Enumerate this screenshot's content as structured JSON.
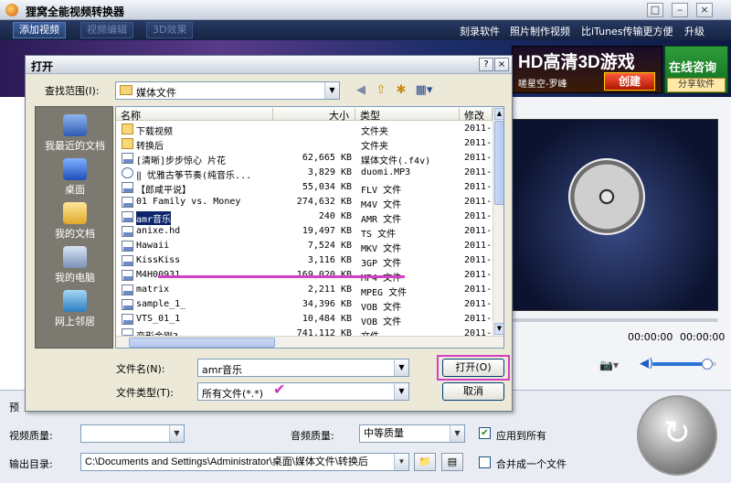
{
  "app": {
    "title": "狸窝全能视频转换器",
    "window_buttons": [
      "□",
      "–",
      "×"
    ],
    "toolbar": {
      "add_video": "添加视频",
      "video_edit": "视频编辑",
      "effect_3d": "3D效果"
    },
    "links": [
      "刻录软件",
      "照片制作视频",
      "比iTunes传输更方便",
      "升级"
    ],
    "banner": {
      "ad_title": "HD高清3D游戏",
      "ad_sub": "嗟星空-罗峰",
      "ad_button": "创建",
      "online_title": "在线咨询",
      "share": "分享软件"
    },
    "player": {
      "time_current": "00:00:00",
      "time_total": "00:00:00",
      "volume": 0.85
    },
    "settings": {
      "preset_label": "预",
      "video_quality_label": "视频质量:",
      "video_quality_value": "",
      "audio_quality_label": "音频质量:",
      "audio_quality_value": "中等质量",
      "apply_all_label": "应用到所有",
      "apply_all_checked": true,
      "output_label": "输出目录:",
      "output_path": "C:\\Documents and Settings\\Administrator\\桌面\\媒体文件\\转换后",
      "merge_label": "合并成一个文件",
      "merge_checked": false
    }
  },
  "dialog": {
    "title": "打开",
    "help": "?",
    "close": "×",
    "look_in_label": "查找范围(I):",
    "look_in_value": "媒体文件",
    "places": [
      {
        "label": "我最近的文档",
        "icon": "recent-documents-icon"
      },
      {
        "label": "桌面",
        "icon": "desktop-icon"
      },
      {
        "label": "我的文档",
        "icon": "my-documents-icon"
      },
      {
        "label": "我的电脑",
        "icon": "my-computer-icon"
      },
      {
        "label": "网上邻居",
        "icon": "network-places-icon"
      }
    ],
    "columns": [
      "名称",
      "大小",
      "类型",
      "修改"
    ],
    "files": [
      {
        "name": "下载视频",
        "size": "",
        "type": "文件夹",
        "date": "2011-",
        "icon": "folder"
      },
      {
        "name": "转换后",
        "size": "",
        "type": "文件夹",
        "date": "2011-",
        "icon": "folder"
      },
      {
        "name": "[清晰]步步惊心 片花",
        "size": "62,665 KB",
        "type": "媒体文件(.f4v)",
        "date": "2011-",
        "icon": "file"
      },
      {
        "name": "‖ 忧雅古筝节奏(纯音乐...",
        "size": "3,829 KB",
        "type": "duomi.MP3",
        "date": "2011-",
        "icon": "media"
      },
      {
        "name": "【郎咸平说】",
        "size": "55,034 KB",
        "type": "FLV 文件",
        "date": "2011-",
        "icon": "file"
      },
      {
        "name": "01 Family vs. Money",
        "size": "274,632 KB",
        "type": "M4V 文件",
        "date": "2011-",
        "icon": "file"
      },
      {
        "name": "amr音乐",
        "size": "240 KB",
        "type": "AMR 文件",
        "date": "2011-",
        "icon": "file",
        "selected": true
      },
      {
        "name": "anixe.hd",
        "size": "19,497 KB",
        "type": "TS 文件",
        "date": "2011-",
        "icon": "file"
      },
      {
        "name": "Hawaii",
        "size": "7,524 KB",
        "type": "MKV 文件",
        "date": "2011-",
        "icon": "file"
      },
      {
        "name": "KissKiss",
        "size": "3,116 KB",
        "type": "3GP 文件",
        "date": "2011-",
        "icon": "file"
      },
      {
        "name": "M4H00931",
        "size": "169,020 KB",
        "type": "MP4 文件",
        "date": "2011-",
        "icon": "file"
      },
      {
        "name": "matrix",
        "size": "2,211 KB",
        "type": "MPEG 文件",
        "date": "2011-",
        "icon": "file"
      },
      {
        "name": "sample_1_",
        "size": "34,396 KB",
        "type": "VOB 文件",
        "date": "2011-",
        "icon": "file"
      },
      {
        "name": "VTS_01_1",
        "size": "10,484 KB",
        "type": "VOB 文件",
        "date": "2011-",
        "icon": "file"
      },
      {
        "name": "变形金刚3",
        "size": "741,112 KB",
        "type": "文件",
        "date": "2011-",
        "icon": "file"
      }
    ],
    "filename_label": "文件名(N):",
    "filename_value": "amr音乐",
    "filetype_label": "文件类型(T):",
    "filetype_value": "所有文件(*.*)",
    "open_button": "打开(O)",
    "cancel_button": "取消"
  }
}
